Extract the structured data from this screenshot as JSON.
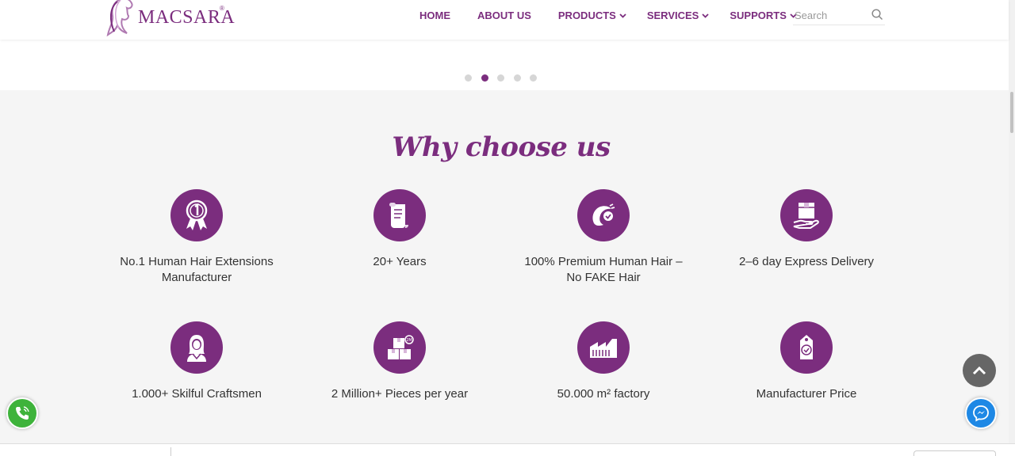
{
  "header": {
    "logo_text": "MACSARA",
    "logo_reg": "®",
    "nav": [
      {
        "label": "HOME",
        "dropdown": false
      },
      {
        "label": "ABOUT US",
        "dropdown": false
      },
      {
        "label": "PRODUCTS",
        "dropdown": true
      },
      {
        "label": "SERVICES",
        "dropdown": true
      },
      {
        "label": "SUPPORTS",
        "dropdown": true
      }
    ],
    "search_placeholder": "Search"
  },
  "slider": {
    "dot_count": 5,
    "active_index": 1
  },
  "why": {
    "title": "Why choose us",
    "features": [
      {
        "icon": "rank-one-medal-icon",
        "label": "No.1 Human Hair Extensions Manufacturer"
      },
      {
        "icon": "scroll-document-icon",
        "label": "20+ Years"
      },
      {
        "icon": "hair-quality-icon",
        "label": "100% Premium Human Hair – No FAKE Hair"
      },
      {
        "icon": "delivery-box-hand-icon",
        "label": "2–6 day Express Delivery"
      },
      {
        "icon": "craftsman-woman-icon",
        "label": "1.000+ Skilful Craftsmen"
      },
      {
        "icon": "boxes-stack-icon",
        "label": "2 Million+ Pieces per year"
      },
      {
        "icon": "factory-icon",
        "label": "50.000 m² factory"
      },
      {
        "icon": "price-tag-icon",
        "label": "Manufacturer Price"
      }
    ]
  },
  "colors": {
    "brand": "#7b2d7e",
    "call": "#3eb33b",
    "messenger": "#1e88e5",
    "back_to_top": "#666666"
  }
}
